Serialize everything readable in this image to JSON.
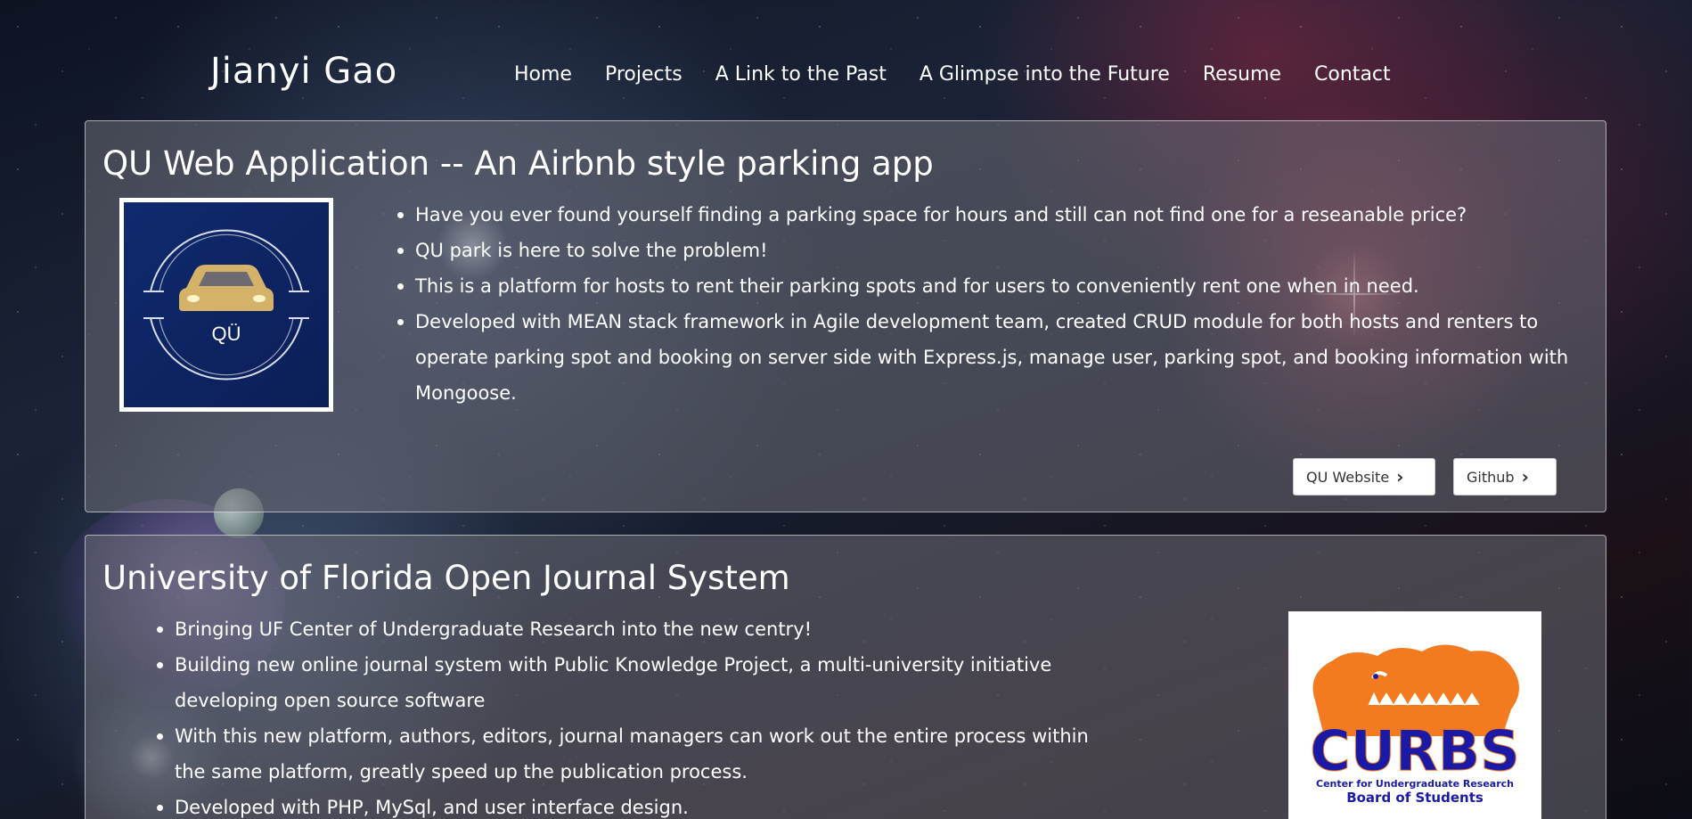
{
  "header": {
    "brand": "Jianyi Gao",
    "nav": [
      {
        "label": "Home"
      },
      {
        "label": "Projects"
      },
      {
        "label": "A Link to the Past"
      },
      {
        "label": "A Glimpse into the Future"
      },
      {
        "label": "Resume"
      },
      {
        "label": "Contact"
      }
    ]
  },
  "projects": [
    {
      "title": "QU Web Application -- An Airbnb style parking app",
      "logo_text": "QÜ",
      "bullets": [
        "Have you ever found yourself finding a parking space for hours and still can not find one for a reseanable price?",
        "QU park is here to solve the problem!",
        "This is a platform for hosts to rent their parking spots and for users to conveniently rent one when in need.",
        "Developed with MEAN stack framework in Agile development team, created CRUD module for both hosts and renters to operate parking spot and booking on server side with Express.js, manage user, parking spot, and booking information with Mongoose."
      ],
      "buttons": [
        {
          "label": "QU Website",
          "icon": "chevron-right-icon"
        },
        {
          "label": "Github",
          "icon": "chevron-right-icon"
        }
      ]
    },
    {
      "title": "University of Florida Open Journal System",
      "logo_text": "CURBS",
      "logo_subtext_1": "Center for Undergraduate Research",
      "logo_subtext_2": "Board of Students",
      "bullets": [
        "Bringing UF Center of Undergraduate Research into the new centry!",
        "Building new online journal system with Public Knowledge Project, a multi-university initiative developing open source software",
        "With this new platform, authors, editors, journal managers can work out the entire process within the same platform, greatly speed up the publication process.",
        "Developed with PHP, MySql, and user interface design."
      ]
    }
  ],
  "colors": {
    "qu_logo_bg": "#0f2a6e",
    "qu_car_gold": "#d4b26a",
    "curbs_orange": "#f47a20",
    "curbs_blue": "#1a1aa6",
    "card_bg": "rgba(110,110,118,0.55)"
  }
}
